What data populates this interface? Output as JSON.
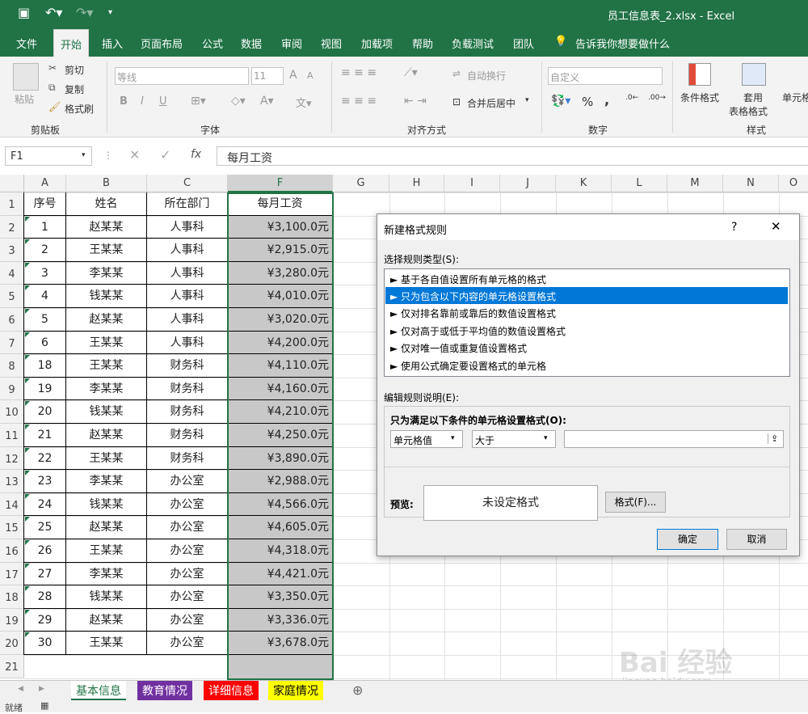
{
  "window": {
    "title": "员工信息表_2.xlsx  -  Excel"
  },
  "colors": {
    "excel_green": "#217346",
    "selection_fill": "#c8c8c8",
    "dialog_select": "#0078d7",
    "tab_education": "#7030a0",
    "tab_detail": "#ff0000",
    "tab_family": "#ffff00"
  },
  "menu": {
    "items": [
      "文件",
      "开始",
      "插入",
      "页面布局",
      "公式",
      "数据",
      "审阅",
      "视图",
      "加载项",
      "帮助",
      "负载测试",
      "团队"
    ],
    "tell_me": "告诉我你想要做什么"
  },
  "ribbon": {
    "clipboard": {
      "paste": "粘贴",
      "cut": "剪切",
      "copy": "复制",
      "format_painter": "格式刷",
      "label": "剪贴板"
    },
    "font": {
      "name": "等线",
      "size": "11",
      "grow": "A",
      "shrink": "A",
      "bold": "B",
      "italic": "I",
      "underline": "U",
      "label": "字体"
    },
    "alignment": {
      "wrap": "自动换行",
      "merge": "合并后居中",
      "label": "对齐方式"
    },
    "number": {
      "format": "自定义",
      "percent": "%",
      "comma": ",",
      "label": "数字"
    },
    "styles": {
      "conditional": "条件格式",
      "table1": "套用",
      "table2": "表格格式",
      "cell": "单元格",
      "label": "样式"
    }
  },
  "formula_bar": {
    "name_box": "F1",
    "fx": "fx",
    "value": "每月工资"
  },
  "columns": [
    "A",
    "B",
    "C",
    "F",
    "G",
    "H",
    "I",
    "J",
    "K",
    "L",
    "M",
    "N",
    "O"
  ],
  "headers": {
    "a": "序号",
    "b": "姓名",
    "c": "所在部门",
    "f": "每月工资"
  },
  "rows": [
    {
      "a": "1",
      "b": "赵某某",
      "c": "人事科",
      "f": "¥3,100.0元"
    },
    {
      "a": "2",
      "b": "王某某",
      "c": "人事科",
      "f": "¥2,915.0元"
    },
    {
      "a": "3",
      "b": "李某某",
      "c": "人事科",
      "f": "¥3,280.0元"
    },
    {
      "a": "4",
      "b": "钱某某",
      "c": "人事科",
      "f": "¥4,010.0元"
    },
    {
      "a": "5",
      "b": "赵某某",
      "c": "人事科",
      "f": "¥3,020.0元"
    },
    {
      "a": "6",
      "b": "王某某",
      "c": "人事科",
      "f": "¥4,200.0元"
    },
    {
      "a": "18",
      "b": "王某某",
      "c": "财务科",
      "f": "¥4,110.0元"
    },
    {
      "a": "19",
      "b": "李某某",
      "c": "财务科",
      "f": "¥4,160.0元"
    },
    {
      "a": "20",
      "b": "钱某某",
      "c": "财务科",
      "f": "¥4,210.0元"
    },
    {
      "a": "21",
      "b": "赵某某",
      "c": "财务科",
      "f": "¥4,250.0元"
    },
    {
      "a": "22",
      "b": "王某某",
      "c": "财务科",
      "f": "¥3,890.0元"
    },
    {
      "a": "23",
      "b": "李某某",
      "c": "办公室",
      "f": "¥2,988.0元"
    },
    {
      "a": "24",
      "b": "钱某某",
      "c": "办公室",
      "f": "¥4,566.0元"
    },
    {
      "a": "25",
      "b": "赵某某",
      "c": "办公室",
      "f": "¥4,605.0元"
    },
    {
      "a": "26",
      "b": "王某某",
      "c": "办公室",
      "f": "¥4,318.0元"
    },
    {
      "a": "27",
      "b": "李某某",
      "c": "办公室",
      "f": "¥4,421.0元"
    },
    {
      "a": "28",
      "b": "钱某某",
      "c": "办公室",
      "f": "¥3,350.0元"
    },
    {
      "a": "29",
      "b": "赵某某",
      "c": "办公室",
      "f": "¥3,336.0元"
    },
    {
      "a": "30",
      "b": "王某某",
      "c": "办公室",
      "f": "¥3,678.0元"
    }
  ],
  "row_numbers": [
    "1",
    "2",
    "3",
    "4",
    "5",
    "6",
    "7",
    "8",
    "9",
    "10",
    "11",
    "12",
    "13",
    "14",
    "15",
    "16",
    "17",
    "18",
    "19",
    "20",
    "21"
  ],
  "dialog": {
    "title": "新建格式规则",
    "help": "?",
    "close": "✕",
    "rule_type_label": "选择规则类型(S):",
    "rules": [
      "► 基于各自值设置所有单元格的格式",
      "► 只为包含以下内容的单元格设置格式",
      "► 仅对排名靠前或靠后的数值设置格式",
      "► 仅对高于或低于平均值的数值设置格式",
      "► 仅对唯一值或重复值设置格式",
      "► 使用公式确定要设置格式的单元格"
    ],
    "edit_label": "编辑规则说明(E):",
    "condition_title": "只为满足以下条件的单元格设置格式(O):",
    "select1": "单元格值",
    "select2": "大于",
    "value": "",
    "preview_label": "预览:",
    "preview_text": "未设定格式",
    "format_button": "格式(F)...",
    "ok": "确定",
    "cancel": "取消"
  },
  "sheets": [
    "基本信息",
    "教育情况",
    "详细信息",
    "家庭情况"
  ],
  "status": {
    "ready": "就绪"
  },
  "watermark": {
    "brand": "Bai  经验",
    "url": "jingyan.baidu.com"
  }
}
